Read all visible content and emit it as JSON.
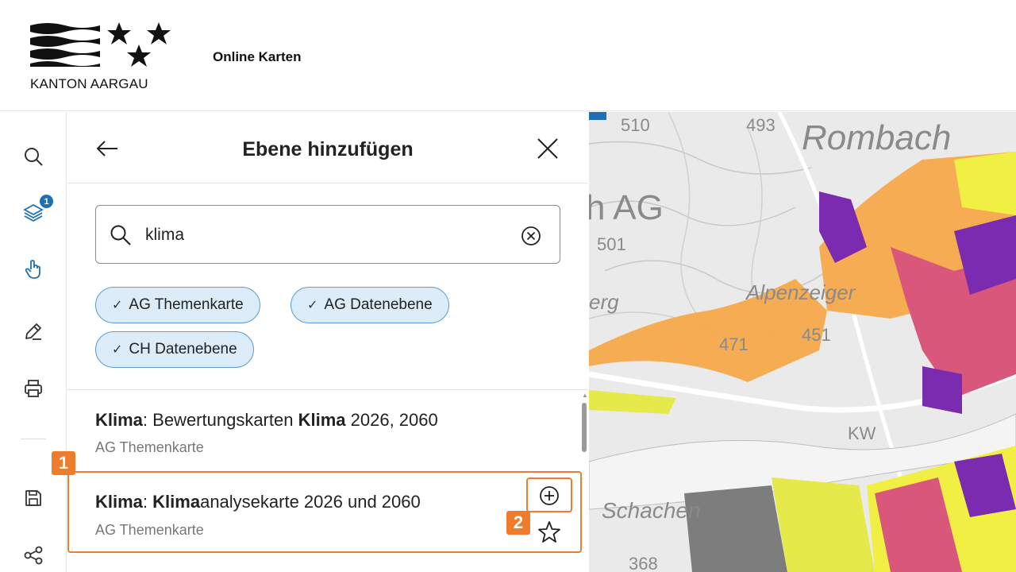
{
  "header": {
    "logo_text": "KANTON AARGAU",
    "app_title": "Online Karten"
  },
  "toolbar": {
    "items": [
      {
        "name": "search",
        "icon": "search-icon"
      },
      {
        "name": "layers",
        "icon": "layers-icon",
        "badge": "1"
      },
      {
        "name": "interact",
        "icon": "hand-pointer-icon"
      },
      {
        "name": "draw",
        "icon": "pencil-icon"
      },
      {
        "name": "print",
        "icon": "printer-icon"
      },
      {
        "name": "save",
        "icon": "save-icon"
      },
      {
        "name": "share",
        "icon": "share-icon"
      }
    ]
  },
  "panel": {
    "title": "Ebene hinzufügen",
    "search": {
      "value": "klima"
    },
    "filters": [
      {
        "label": "AG Themenkarte",
        "checked": true
      },
      {
        "label": "AG Datenebene",
        "checked": true
      },
      {
        "label": "CH Datenebene",
        "checked": true
      }
    ],
    "results": [
      {
        "title_bold_1": "Klima",
        "title_plain_1": ": Bewertungskarten ",
        "title_bold_2": "Klima",
        "title_plain_2": " 2026, 2060",
        "category": "AG Themenkarte"
      },
      {
        "title_bold_1": "Klima",
        "title_plain_1": ": ",
        "title_bold_2": "Klima",
        "title_plain_2": "analysekarte 2026 und 2060",
        "category": "AG Themenkarte"
      }
    ]
  },
  "markers": {
    "step1": "1",
    "step2": "2"
  },
  "map": {
    "labels": {
      "rombach": "Rombach",
      "ag": "h AG",
      "alpenzeiger": "Alpenzeiger",
      "schachen": "Schachen",
      "erg": "erg",
      "kw": "KW"
    },
    "numbers": {
      "n510": "510",
      "n493": "493",
      "n501": "501",
      "n471": "471",
      "n451": "451",
      "n368": "368"
    }
  },
  "colors": {
    "accent": "#1f6fb5",
    "highlight": "#ee7c2a",
    "chip_bg": "#dcecf8",
    "chip_border": "#5a9fd6"
  }
}
